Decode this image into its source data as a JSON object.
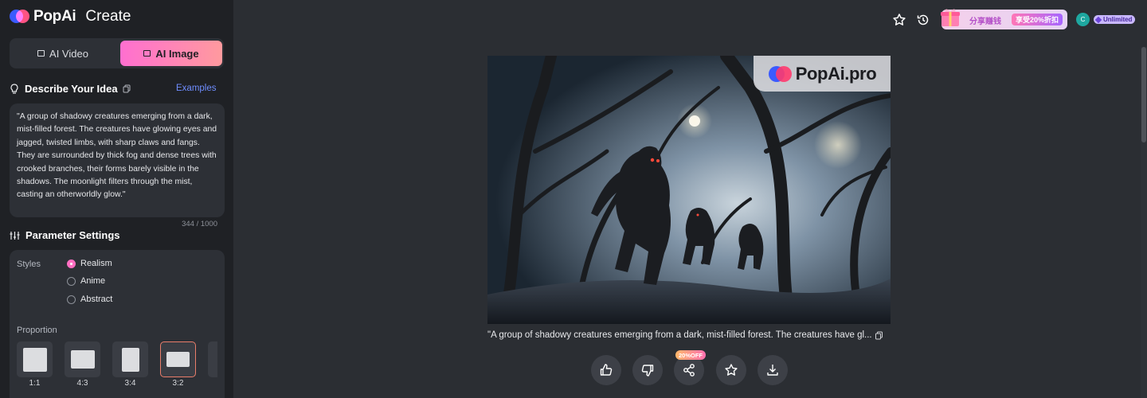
{
  "brand": {
    "name": "PopAi",
    "section": "Create"
  },
  "mode_switch": {
    "video_label": "AI Video",
    "image_label": "AI Image",
    "selected": "AI Image"
  },
  "idea": {
    "title": "Describe Your Idea",
    "examples_label": "Examples",
    "prompt": "\"A group of shadowy creatures emerging from a dark, mist-filled forest. The creatures have glowing eyes and jagged, twisted limbs, with sharp claws and fangs. They are surrounded by thick fog and dense trees with crooked branches, their forms barely visible in the shadows. The moonlight filters through the mist, casting an otherworldly glow.\"",
    "char_count": "344 / 1000"
  },
  "params": {
    "title": "Parameter Settings",
    "styles_label": "Styles",
    "styles": [
      "Realism",
      "Anime",
      "Abstract"
    ],
    "selected_style": "Realism",
    "proportion_label": "Proportion",
    "ratios": [
      "1:1",
      "4:3",
      "3:4",
      "3:2"
    ],
    "selected_ratio": "3:2"
  },
  "topbar": {
    "promo_text": "分享赚钱",
    "promo_badge": "享受20%折扣",
    "avatar_initial": "C",
    "plan": "Unlimited"
  },
  "result": {
    "watermark": "PopAi.pro",
    "caption": "\"A group of shadowy creatures emerging from a dark, mist-filled forest. The creatures have gl...",
    "share_badge": "20%OFF"
  },
  "colors": {
    "accent_gradient_start": "#ff6fd0",
    "accent_gradient_end": "#ff9a9e",
    "link": "#6f8dff",
    "sidebar_bg": "#1f2125",
    "main_bg": "#2b2e33"
  }
}
